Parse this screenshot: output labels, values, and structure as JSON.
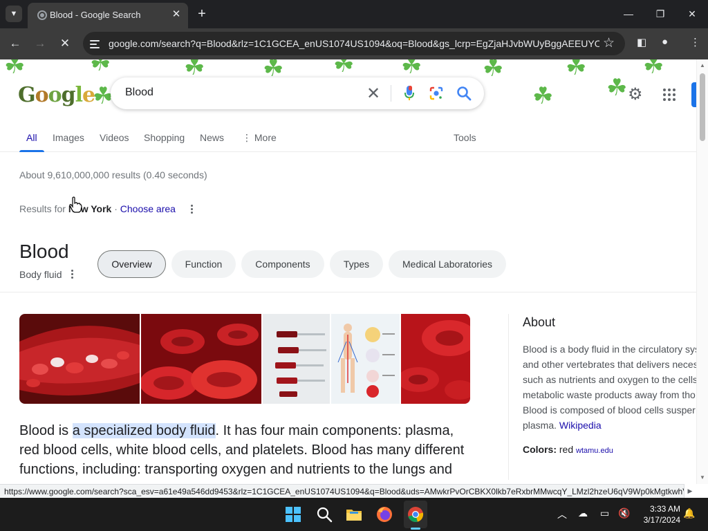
{
  "browser": {
    "tab_title": "Blood - Google Search",
    "url": "google.com/search?q=Blood&rlz=1C1GCEA_enUS1074US1094&oq=Blood&gs_lcrp=EgZjaHJvbWUyBggAEEUYO...",
    "status_url": "https://www.google.com/search?sca_esv=a61e49a546dd9453&rlz=1C1GCEA_enUS1074US1094&q=Blood&uds=AMwkrPvOrCBKX0lkb7eRxbrMMwcqY_LMzl2hzeU6qV9Wp0kMgtkwhV..."
  },
  "search": {
    "query": "Blood"
  },
  "logo": {
    "letters": [
      "G",
      "o",
      "o",
      "g",
      "l",
      "e"
    ]
  },
  "nav": {
    "tabs": [
      {
        "label": "All"
      },
      {
        "label": "Images"
      },
      {
        "label": "Videos"
      },
      {
        "label": "Shopping"
      },
      {
        "label": "News"
      },
      {
        "label": "More"
      }
    ],
    "tools": "Tools"
  },
  "results": {
    "stats": "About 9,610,000,000 results (0.40 seconds)",
    "results_for_prefix": "Results for",
    "location": "New York",
    "separator": "·",
    "choose_area": "Choose area"
  },
  "entity": {
    "title": "Blood",
    "subtitle": "Body fluid",
    "chips": [
      {
        "label": "Overview"
      },
      {
        "label": "Function"
      },
      {
        "label": "Components"
      },
      {
        "label": "Types"
      },
      {
        "label": "Medical Laboratories"
      }
    ]
  },
  "description": {
    "before": "Blood is ",
    "highlight": "a specialized body fluid",
    "after": ". It has four main components: plasma, red blood cells, white blood cells, and platelets. Blood has many different functions, including: transporting oxygen and nutrients to the lungs and"
  },
  "about": {
    "title": "About",
    "lines": [
      "Blood is a body fluid in the circulatory sys",
      "and other vertebrates that delivers neces",
      "such as nutrients and oxygen to the cells",
      "metabolic waste products away from tho",
      "Blood is composed of blood cells susper"
    ],
    "last_line_prefix": "plasma.",
    "wiki_link": "Wikipedia",
    "colors_label": "Colors:",
    "colors_value": "red",
    "colors_source": "wtamu.edu"
  },
  "taskbar": {
    "time": "3:33 AM",
    "date": "3/17/2024"
  },
  "colors": {
    "chrome_bg": "#202124",
    "toolbar_bg": "#3c3c3c",
    "link": "#1a0dab",
    "accent_blue": "#1a73e8",
    "highlight": "#d3e3fd",
    "clover_green": "#5db84a"
  }
}
